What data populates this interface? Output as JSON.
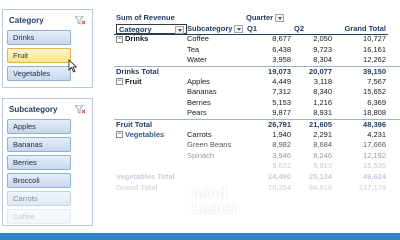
{
  "slicers": {
    "category": {
      "title": "Category",
      "items": [
        "Drinks",
        "Fruit",
        "Vegetables"
      ]
    },
    "subcategory": {
      "title": "Subcategory",
      "items": [
        "Apples",
        "Bananas",
        "Berries",
        "Broccoli",
        "Carrots",
        "Coffee"
      ]
    }
  },
  "pivot": {
    "values_label": "Sum of Revenue",
    "column_field": "Quarter",
    "row_field": "Category",
    "subrow_field": "Subcategory",
    "col_q1": "Q1",
    "col_q2": "Q2",
    "col_total": "Grand Total",
    "drinks": {
      "label": "Drinks",
      "rows": [
        {
          "sub": "Coffee",
          "q1": "8,677",
          "q2": "2,050",
          "gt": "10,727"
        },
        {
          "sub": "Tea",
          "q1": "6,438",
          "q2": "9,723",
          "gt": "16,161"
        },
        {
          "sub": "Water",
          "q1": "3,958",
          "q2": "8,304",
          "gt": "12,262"
        }
      ],
      "total": {
        "label": "Drinks Total",
        "q1": "19,073",
        "q2": "20,077",
        "gt": "39,150"
      }
    },
    "fruit": {
      "label": "Fruit",
      "rows": [
        {
          "sub": "Apples",
          "q1": "4,449",
          "q2": "3,118",
          "gt": "7,567"
        },
        {
          "sub": "Bananas",
          "q1": "7,312",
          "q2": "8,340",
          "gt": "15,652"
        },
        {
          "sub": "Berries",
          "q1": "5,153",
          "q2": "1,216",
          "gt": "6,369"
        },
        {
          "sub": "Pears",
          "q1": "9,877",
          "q2": "8,931",
          "gt": "18,808"
        }
      ],
      "total": {
        "label": "Fruit Total",
        "q1": "26,791",
        "q2": "21,605",
        "gt": "48,396"
      }
    },
    "vegetables": {
      "label": "Vegetables",
      "rows": [
        {
          "sub": "Carrots",
          "q1": "1,940",
          "q2": "2,291",
          "gt": "4,231"
        },
        {
          "sub": "Green Beans",
          "q1": "8,982",
          "q2": "8,684",
          "gt": "17,666"
        },
        {
          "sub": "Spinach",
          "q1": "3,946",
          "q2": "8,246",
          "gt": "12,192"
        },
        {
          "sub": "",
          "q1": "9,622",
          "q2": "5,913",
          "gt": "15,535"
        }
      ],
      "total": {
        "label": "Vegetables Total",
        "q1": "24,490",
        "q2": "25,134",
        "gt": "49,624"
      }
    },
    "grand_total": {
      "label": "Grand Total",
      "q1": "70,354",
      "q2": "66,816",
      "gt": "137,170"
    }
  },
  "watermark": {
    "line1": "Mind",
    "line2": "Luster"
  },
  "colors": {
    "accent": "#2f86c8",
    "header_text": "#1f3a5a",
    "slicer_hover": "#fbe28a"
  }
}
